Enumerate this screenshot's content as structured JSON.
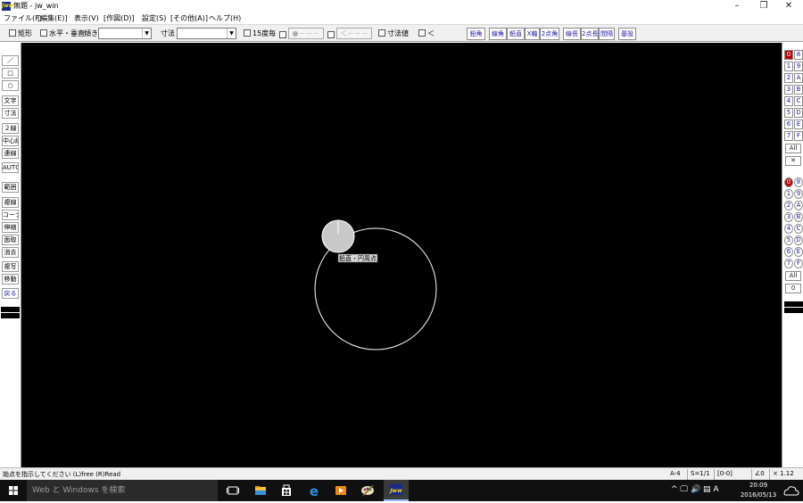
{
  "window": {
    "app_icon_text": "Jww",
    "title": "無題 - jw_win",
    "minimize": "–",
    "maximize": "❐",
    "close": "✕"
  },
  "menu": [
    "ファイル(F)",
    "[編集(E)]",
    "表示(V)",
    "[作図(D)]",
    "設定(S)",
    "[その他(A)]",
    "ヘルプ(H)"
  ],
  "toolbar": {
    "rect_label": "矩形",
    "hv_label": "水平・垂直",
    "slope_label": "傾き",
    "dimension_label": "寸法",
    "deg15_label": "15度毎",
    "dim_button_1": "●－－－",
    "dim_button_2": "＜－－－",
    "dimvalue_label": "寸法値",
    "arrow_label": "＜",
    "commands": [
      "鉛角",
      "線角",
      "鉛直",
      "X軸",
      "2点角",
      "線長",
      "2点長",
      "間隔",
      "基設"
    ]
  },
  "left_tools": [
    "／",
    "□",
    "○",
    "文字",
    "寸法",
    "２線",
    "中心線",
    "連線",
    "AUTO",
    "範囲",
    "複線",
    "コーナー",
    "伸縮",
    "面取",
    "消去",
    "複写",
    "移動",
    "戻る"
  ],
  "canvas": {
    "tooltip": "鉛直・円周点",
    "colors": {
      "background": "#000000",
      "circle": "#ffffff",
      "cursor_fill": "#c8c8c8"
    }
  },
  "right_panel": {
    "layer_groups": [
      [
        "0",
        "8"
      ],
      [
        "1",
        "9"
      ],
      [
        "2",
        "A"
      ],
      [
        "3",
        "B"
      ],
      [
        "4",
        "C"
      ],
      [
        "5",
        "D"
      ],
      [
        "6",
        "E"
      ],
      [
        "7",
        "F"
      ]
    ],
    "all_label": "All",
    "x_label": "✕",
    "zero_label": "0"
  },
  "status": {
    "message": "始点を指示してください (L)free (R)Read",
    "paper": "A-4",
    "scale": "S=1/1",
    "layer": "[0-0]",
    "angle": "∠0",
    "zoom": "× 1.12"
  },
  "taskbar": {
    "search_placeholder": "Web と Windows を検索",
    "time": "20:09",
    "date": "2016/05/13",
    "tray_text": "^ 🖵 🔊 ▤ A"
  }
}
